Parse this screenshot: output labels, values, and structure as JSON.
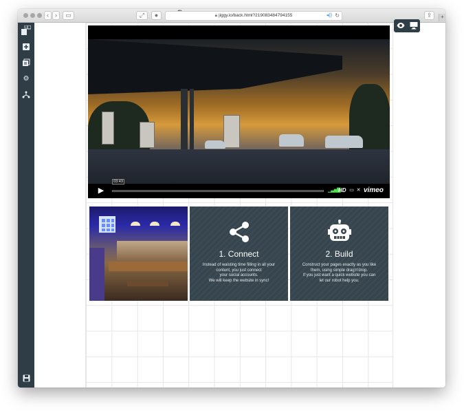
{
  "browser": {
    "url": "jiggy.io/back.html?219083484794155",
    "tab_count": "2",
    "reader_label": "⌸"
  },
  "sidebar": {
    "items": [
      {
        "icon": "layout-grid-icon"
      },
      {
        "icon": "add-square-icon"
      },
      {
        "icon": "pages-icon"
      },
      {
        "icon": "gear-icon"
      },
      {
        "icon": "sitemap-icon"
      },
      {
        "icon": "save-icon"
      }
    ]
  },
  "view_buttons": {
    "preview_icon": "eye-icon",
    "desktop_icon": "monitor-icon"
  },
  "video": {
    "current_time": "03:43",
    "quality_label": "HD",
    "brand": "vimeo"
  },
  "cards": [
    {
      "title": "1. Connect",
      "description": [
        "Instead of waisting time filling in all your",
        "content, you just connect",
        "your social accounts.",
        "We will keep the website in sync!"
      ],
      "icon": "share-icon"
    },
    {
      "title": "2. Build",
      "description": [
        "Construct your pages exactly as you like",
        "them, using simple drag'n'drop.",
        "If you just want a quick website you can",
        "let our robot help you."
      ],
      "icon": "robot-icon"
    }
  ],
  "colors": {
    "sidebar": "#2f3e46",
    "card": "#37464e",
    "accent_volume": "#4fe04f"
  }
}
